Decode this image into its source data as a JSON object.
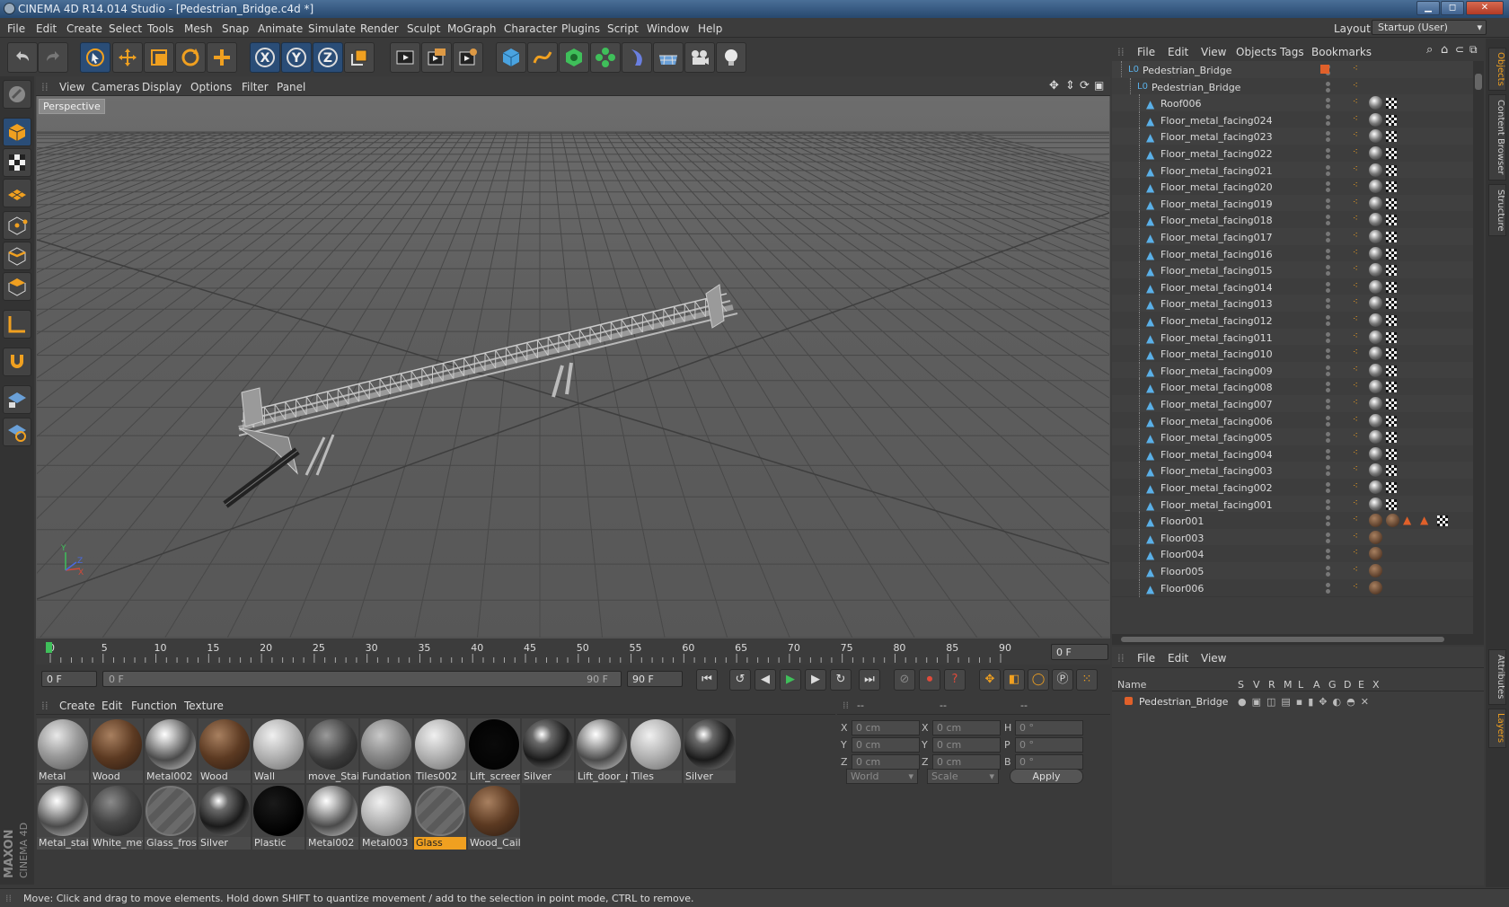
{
  "window": {
    "title": "CINEMA 4D R14.014 Studio - [Pedestrian_Bridge.c4d *]",
    "min": "▁",
    "max": "◻",
    "close": "✕"
  },
  "menubar": {
    "items": [
      "File",
      "Edit",
      "Create",
      "Select",
      "Tools",
      "Mesh",
      "Snap",
      "Animate",
      "Simulate",
      "Render",
      "Sculpt",
      "MoGraph",
      "Character",
      "Plugins",
      "Script",
      "Window",
      "Help"
    ],
    "layout_label": "Layout:",
    "layout_value": "Startup (User)"
  },
  "toolbar": {
    "icons": [
      "undo-icon",
      "redo-icon",
      "live-selection-icon",
      "move-icon",
      "scale-icon",
      "rotate-icon",
      "add-icon",
      "x-axis-icon",
      "y-axis-icon",
      "z-axis-icon",
      "coordinate-system-icon",
      "render-view-icon",
      "render-picture-viewer-icon",
      "render-settings-icon",
      "cube-icon",
      "spline-icon",
      "nurbs-icon",
      "array-icon",
      "deformer-icon",
      "floor-icon",
      "camera-icon",
      "light-icon"
    ],
    "axis_labels": [
      "X",
      "Y",
      "Z"
    ]
  },
  "left_tools": [
    "make-editable-icon",
    "model-mode-icon",
    "texture-mode-icon",
    "workplane-icon",
    "points-mode-icon",
    "edges-mode-icon",
    "polygons-mode-icon",
    "axis-mode-icon",
    "magnet-icon",
    "locked-workplane-icon",
    "snap-icon"
  ],
  "viewport": {
    "menu": [
      "View",
      "Cameras",
      "Display",
      "Options",
      "Filter",
      "Panel"
    ],
    "label": "Perspective",
    "axis_labels": [
      "Y",
      "Z",
      "X"
    ]
  },
  "timeline": {
    "ticks": [
      "0",
      "5",
      "10",
      "15",
      "20",
      "25",
      "30",
      "35",
      "40",
      "45",
      "50",
      "55",
      "60",
      "65",
      "70",
      "75",
      "80",
      "85",
      "90"
    ],
    "current_frame": "0 F"
  },
  "transport": {
    "start": "0 F",
    "range_start": "0 F",
    "range_end": "90 F",
    "end": "90 F"
  },
  "materials": {
    "menu": [
      "Create",
      "Edit",
      "Function",
      "Texture"
    ],
    "items": [
      {
        "name": "Metal",
        "kind": "matte-grey"
      },
      {
        "name": "Wood",
        "kind": "wood"
      },
      {
        "name": "Metal002",
        "kind": "chrome"
      },
      {
        "name": "Wood",
        "kind": "wood"
      },
      {
        "name": "Wall",
        "kind": "light-grey"
      },
      {
        "name": "move_Stair",
        "kind": "dark-grid"
      },
      {
        "name": "Fundation",
        "kind": "mid-grey"
      },
      {
        "name": "Tiles002",
        "kind": "light-grey"
      },
      {
        "name": "Lift_screen",
        "kind": "black-screen"
      },
      {
        "name": "Silver",
        "kind": "dark-chrome"
      },
      {
        "name": "Lift_door_n",
        "kind": "chrome"
      },
      {
        "name": "Tiles",
        "kind": "light-grey"
      },
      {
        "name": "Silver",
        "kind": "dark-chrome"
      },
      {
        "name": "Metal_stair",
        "kind": "chrome"
      },
      {
        "name": "White_met",
        "kind": "dark-grey"
      },
      {
        "name": "Glass_frost",
        "kind": "glass"
      },
      {
        "name": "Silver",
        "kind": "dark-chrome"
      },
      {
        "name": "Plastic",
        "kind": "black"
      },
      {
        "name": "Metal002",
        "kind": "chrome"
      },
      {
        "name": "Metal003",
        "kind": "light-grey"
      },
      {
        "name": "Glass",
        "kind": "glass",
        "selected": true
      },
      {
        "name": "Wood_Cail",
        "kind": "wood"
      }
    ]
  },
  "coords": {
    "header": [
      "--",
      "--",
      "--"
    ],
    "rows": [
      {
        "l1": "X",
        "v1": "0 cm",
        "l2": "X",
        "v2": "0 cm",
        "l3": "H",
        "v3": "0 °"
      },
      {
        "l1": "Y",
        "v1": "0 cm",
        "l2": "Y",
        "v2": "0 cm",
        "l3": "P",
        "v3": "0 °"
      },
      {
        "l1": "Z",
        "v1": "0 cm",
        "l2": "Z",
        "v2": "0 cm",
        "l3": "B",
        "v3": "0 °"
      }
    ],
    "mode": "World",
    "scale": "Scale",
    "apply": "Apply"
  },
  "object_manager": {
    "menu": [
      "File",
      "Edit",
      "View",
      "Objects",
      "Tags",
      "Bookmarks"
    ],
    "root": "Pedestrian_Bridge",
    "group": "Pedestrian_Bridge",
    "objects": [
      "Roof006",
      "Floor_metal_facing024",
      "Floor_metal_facing023",
      "Floor_metal_facing022",
      "Floor_metal_facing021",
      "Floor_metal_facing020",
      "Floor_metal_facing019",
      "Floor_metal_facing018",
      "Floor_metal_facing017",
      "Floor_metal_facing016",
      "Floor_metal_facing015",
      "Floor_metal_facing014",
      "Floor_metal_facing013",
      "Floor_metal_facing012",
      "Floor_metal_facing011",
      "Floor_metal_facing010",
      "Floor_metal_facing009",
      "Floor_metal_facing008",
      "Floor_metal_facing007",
      "Floor_metal_facing006",
      "Floor_metal_facing005",
      "Floor_metal_facing004",
      "Floor_metal_facing003",
      "Floor_metal_facing002",
      "Floor_metal_facing001",
      "Floor001",
      "Floor003",
      "Floor004",
      "Floor005",
      "Floor006"
    ]
  },
  "layer_manager": {
    "menu": [
      "File",
      "Edit",
      "View"
    ],
    "columns": [
      "Name",
      "S",
      "V",
      "R",
      "M",
      "L",
      "A",
      "G",
      "D",
      "E",
      "X"
    ],
    "layers": [
      "Pedestrian_Bridge"
    ]
  },
  "right_tabs": [
    "Objects",
    "Content Browser",
    "Structure",
    "Attributes",
    "Layers"
  ],
  "status": "Move: Click and drag to move elements. Hold down SHIFT to quantize movement / add to the selection in point mode, CTRL to remove.",
  "brand": {
    "line1": "MAXON",
    "line2": "CINEMA 4D"
  },
  "colors": {
    "accent_orange": "#f0a020",
    "selection_blue": "#2a4d77",
    "title_blue": "#3a5f8a"
  }
}
